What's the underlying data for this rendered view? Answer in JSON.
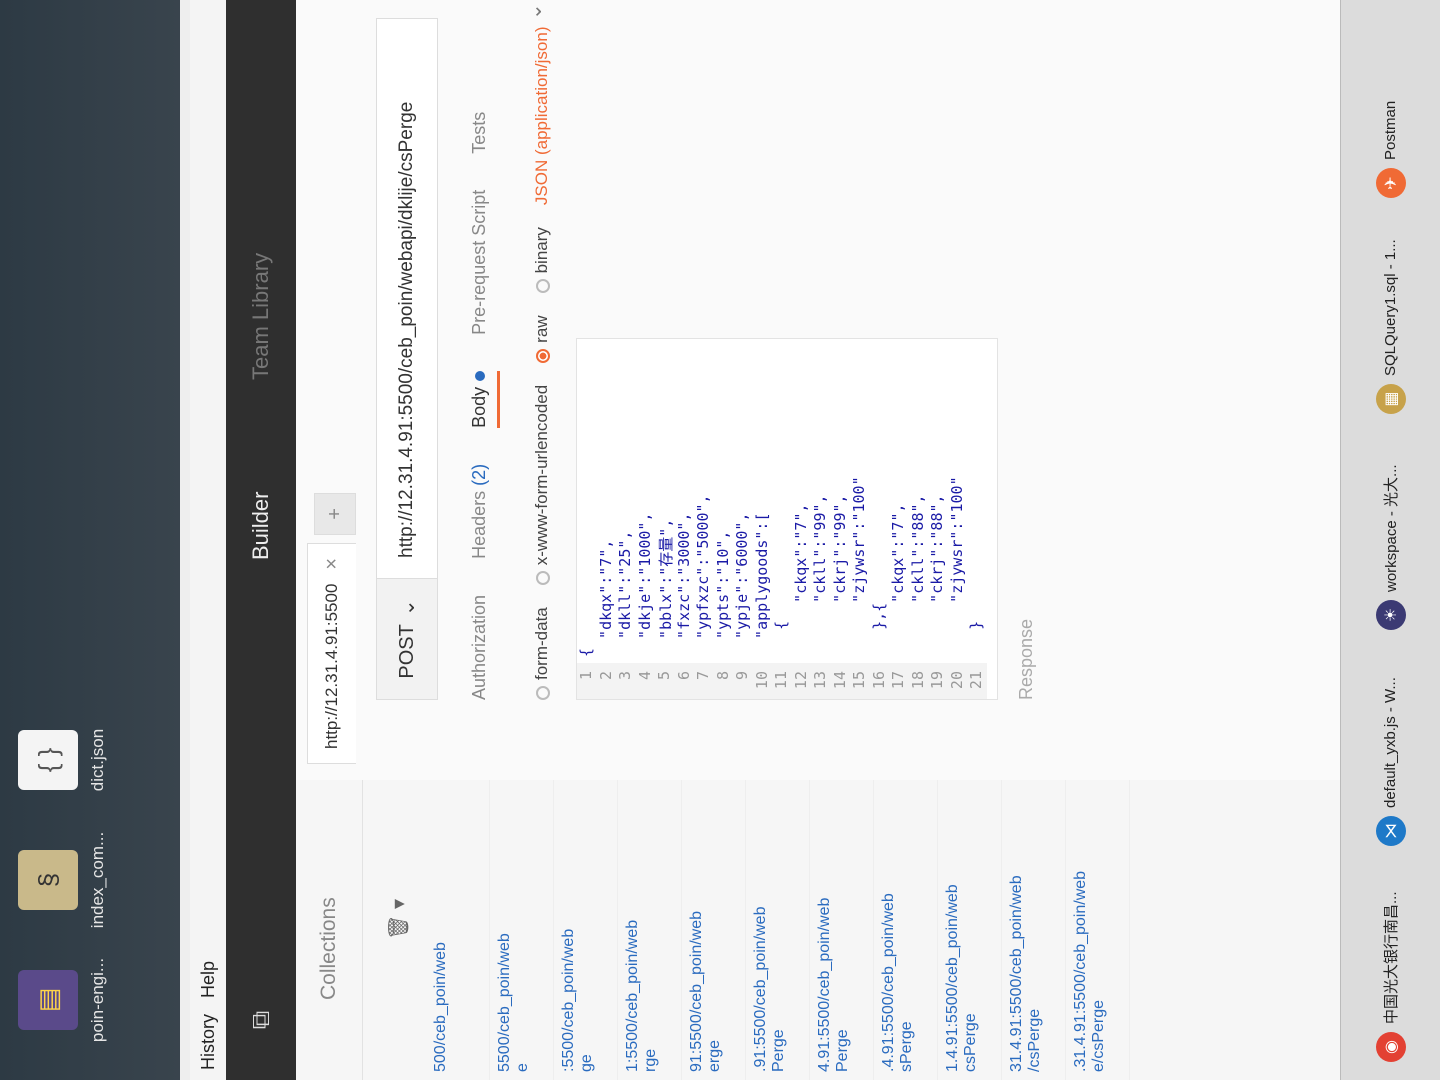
{
  "desktop": {
    "icons": [
      {
        "name": "poin-engi...",
        "icon": "archive-icon"
      },
      {
        "name": "index_com...",
        "icon": "script-icon"
      },
      {
        "name": "dict.json",
        "icon": "json-file-icon"
      }
    ]
  },
  "menubar": {
    "items": [
      "History",
      "Help"
    ]
  },
  "header": {
    "builder_label": "Builder",
    "team_label": "Team Library"
  },
  "sidebar": {
    "collections_label": "Collections",
    "history": [
      {
        "url": "500/ceb_poin/web",
        "sub": ""
      },
      {
        "url": "5500/ceb_poin/web",
        "sub": "e"
      },
      {
        "url": ":5500/ceb_poin/web",
        "sub": "ge"
      },
      {
        "url": "1:5500/ceb_poin/web",
        "sub": "rge"
      },
      {
        "url": "91:5500/ceb_poin/web",
        "sub": "erge"
      },
      {
        "url": ".91:5500/ceb_poin/web",
        "sub": "Perge"
      },
      {
        "url": "4.91:5500/ceb_poin/web",
        "sub": "Perge"
      },
      {
        "url": ".4.91:5500/ceb_poin/web",
        "sub": "sPerge"
      },
      {
        "url": "1.4.91:5500/ceb_poin/web",
        "sub": "csPerge"
      },
      {
        "url": "31.4.91:5500/ceb_poin/web",
        "sub": "/csPerge"
      },
      {
        "url": ".31.4.91:5500/ceb_poin/web",
        "sub": "e/csPerge"
      }
    ]
  },
  "request": {
    "tab_title": "http://12.31.4.91:5500",
    "method": "POST",
    "url": "http://12.31.4.91:5500/ceb_poin/webapi/dklije/csPerge",
    "tabs": {
      "authorization": "Authorization",
      "headers": "Headers",
      "headers_count": "(2)",
      "body": "Body",
      "prerequest": "Pre-request Script",
      "tests": "Tests"
    },
    "body_options": {
      "form_data": "form-data",
      "urlencoded": "x-www-form-urlencoded",
      "raw": "raw",
      "binary": "binary",
      "content_type": "JSON (application/json)"
    },
    "code_lines": [
      {
        "n": "1",
        "t": "{"
      },
      {
        "n": "2",
        "t": "  \"dkqx\":\"7\","
      },
      {
        "n": "3",
        "t": "  \"dkll\":\"25\","
      },
      {
        "n": "4",
        "t": "  \"dkje\":\"1000\","
      },
      {
        "n": "5",
        "t": "  \"bblx\":\"存量\","
      },
      {
        "n": "6",
        "t": "  \"fxzc\":\"3000\","
      },
      {
        "n": "7",
        "t": "  \"ypfxzc\":\"5000\","
      },
      {
        "n": "8",
        "t": "  \"ypts\":\"10\","
      },
      {
        "n": "9",
        "t": "  \"ypje\":\"6000\","
      },
      {
        "n": "10",
        "t": "  \"applygoods\":["
      },
      {
        "n": "11",
        "t": "   {"
      },
      {
        "n": "12",
        "t": "      \"ckqx\":\"7\","
      },
      {
        "n": "13",
        "t": "      \"ckll\":\"99\","
      },
      {
        "n": "14",
        "t": "      \"ckrj\":\"99\","
      },
      {
        "n": "15",
        "t": "      \"zjywsr\":\"100\""
      },
      {
        "n": "16",
        "t": "   },{"
      },
      {
        "n": "17",
        "t": "      \"ckqx\":\"7\","
      },
      {
        "n": "18",
        "t": "      \"ckll\":\"88\","
      },
      {
        "n": "19",
        "t": "      \"ckrj\":\"88\","
      },
      {
        "n": "20",
        "t": "      \"zjywsr\":\"100\""
      },
      {
        "n": "21",
        "t": "   }"
      }
    ],
    "response_label": "Response"
  },
  "taskbar": {
    "items": [
      {
        "label": "中国光大银行南昌...",
        "icon": "chrome-icon",
        "color": "#e34133"
      },
      {
        "label": "default_yxb.js - W...",
        "icon": "vscode-icon",
        "color": "#1e79c8"
      },
      {
        "label": "workspace - 光大...",
        "icon": "eclipse-icon",
        "color": "#3b3a73"
      },
      {
        "label": "SQLQuery1.sql - 1...",
        "icon": "sql-icon",
        "color": "#c7a24a"
      },
      {
        "label": "Postman",
        "icon": "postman-icon",
        "color": "#f06a35"
      }
    ]
  }
}
